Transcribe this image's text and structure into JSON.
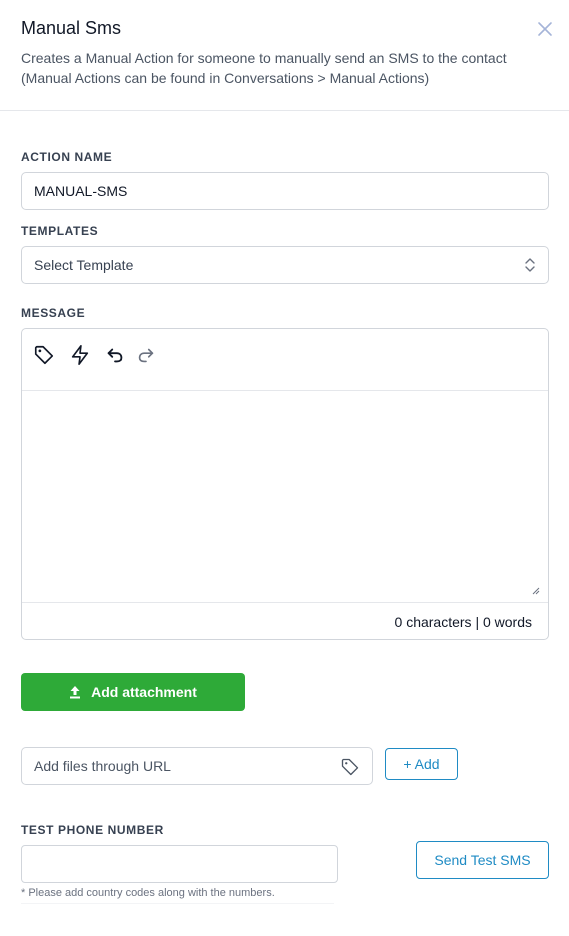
{
  "header": {
    "title": "Manual Sms",
    "description": "Creates a Manual Action for someone to manually send an SMS to the contact (Manual Actions can be found in Conversations > Manual Actions)",
    "close_icon": "close-icon"
  },
  "form": {
    "action_name": {
      "label": "ACTION NAME",
      "value": "MANUAL-SMS"
    },
    "templates": {
      "label": "TEMPLATES",
      "value": "Select Template"
    },
    "message": {
      "label": "MESSAGE",
      "toolbar_icons": [
        "tag-icon",
        "lightning-icon",
        "undo-icon",
        "redo-icon"
      ],
      "value": "",
      "counter": "0 characters | 0 words"
    },
    "attachment": {
      "button_label": "Add attachment",
      "icon": "upload-icon"
    },
    "url": {
      "placeholder": "Add files through URL",
      "add_label": "+ Add"
    },
    "test_phone": {
      "label": "TEST PHONE NUMBER",
      "value": "",
      "send_label": "Send Test SMS",
      "hint": "* Please add country codes along with the numbers."
    }
  },
  "colors": {
    "primary_green": "#2eaa38",
    "accent_blue": "#1f8bc4",
    "border": "#d1d5db"
  }
}
